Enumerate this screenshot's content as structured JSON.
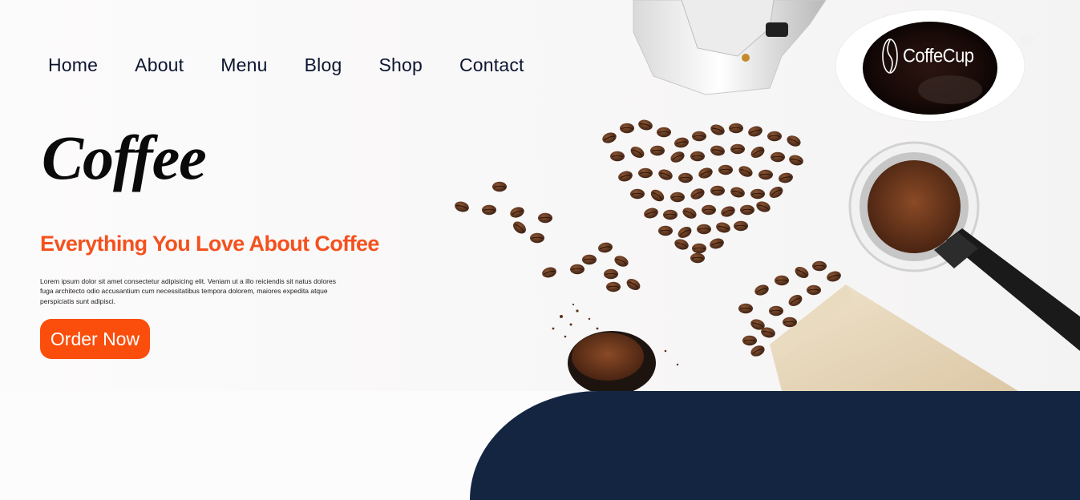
{
  "nav": {
    "items": [
      "Home",
      "About",
      "Menu",
      "Blog",
      "Shop",
      "Contact"
    ]
  },
  "brand": {
    "logo_text": "CoffeCup",
    "logo_icon": "coffee-bean-icon"
  },
  "hero": {
    "title": "Coffee",
    "tagline": "Everything You Love About Coffee",
    "description": "Lorem ipsum dolor sit amet consectetur adipisicing elit. Veniam ut a illo reiciendis sit natus dolores fuga architecto odio accusantium cum necessitatibus tempora dolorem, maiores expedita atque perspiciatis sunt adipisci.",
    "cta_label": "Order Now"
  },
  "colors": {
    "accent": "#fb4d0b",
    "tagline": "#f4511e",
    "navy": "#142542",
    "nav_text": "#0c1530"
  }
}
